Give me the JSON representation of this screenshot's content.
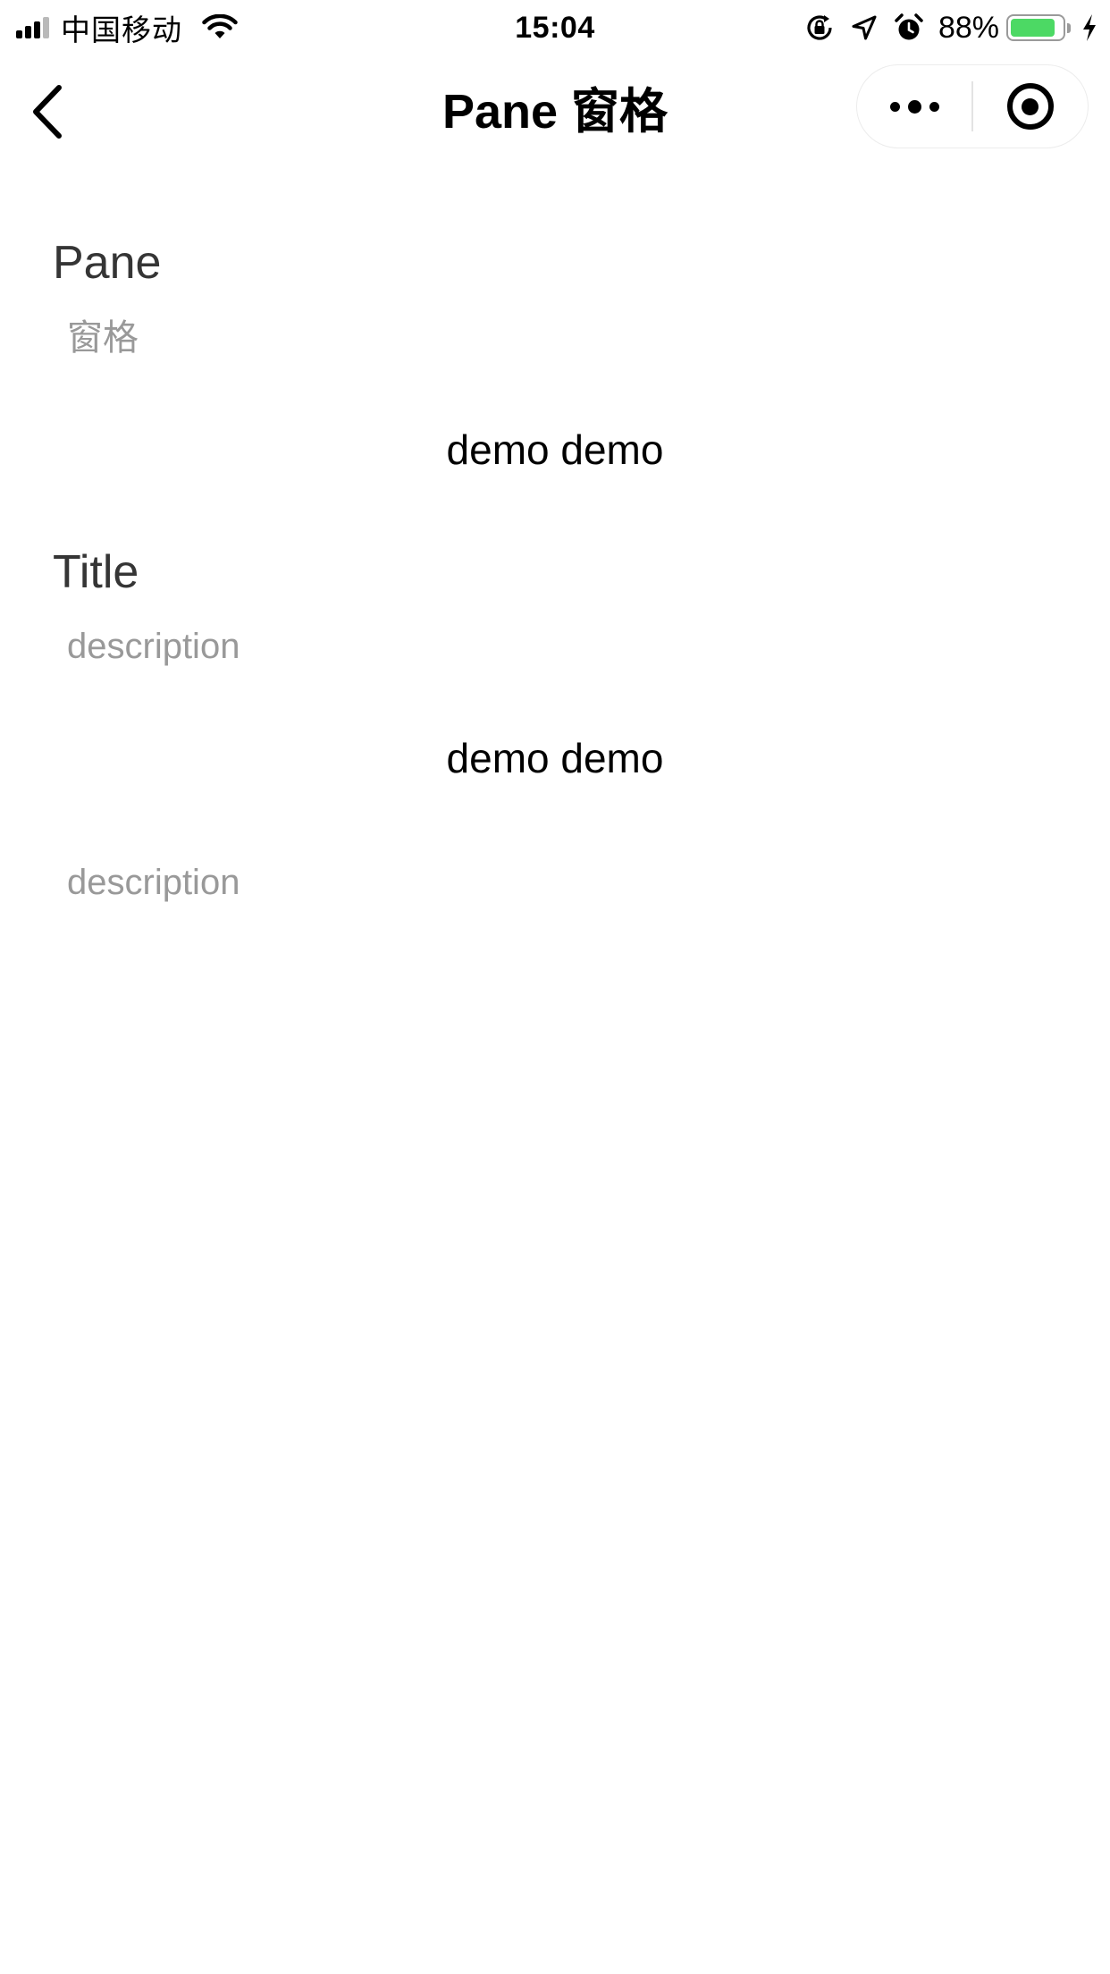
{
  "status_bar": {
    "carrier": "中国移动",
    "time": "15:04",
    "battery_percent": "88%",
    "battery_level": 0.88,
    "battery_color": "#4cd964",
    "icons": [
      "signal-icon",
      "wifi-icon",
      "orientation-lock-icon",
      "location-icon",
      "alarm-icon",
      "battery-icon",
      "charging-icon"
    ]
  },
  "nav": {
    "title": "Pane 窗格",
    "back_icon": "chevron-left-icon",
    "more_icon": "more-dots-icon",
    "close_icon": "record-icon"
  },
  "panes": [
    {
      "title": "Pane",
      "description": "窗格",
      "content": "demo demo"
    },
    {
      "title": "Title",
      "description": "description",
      "content": "demo demo",
      "footer": "description"
    }
  ]
}
